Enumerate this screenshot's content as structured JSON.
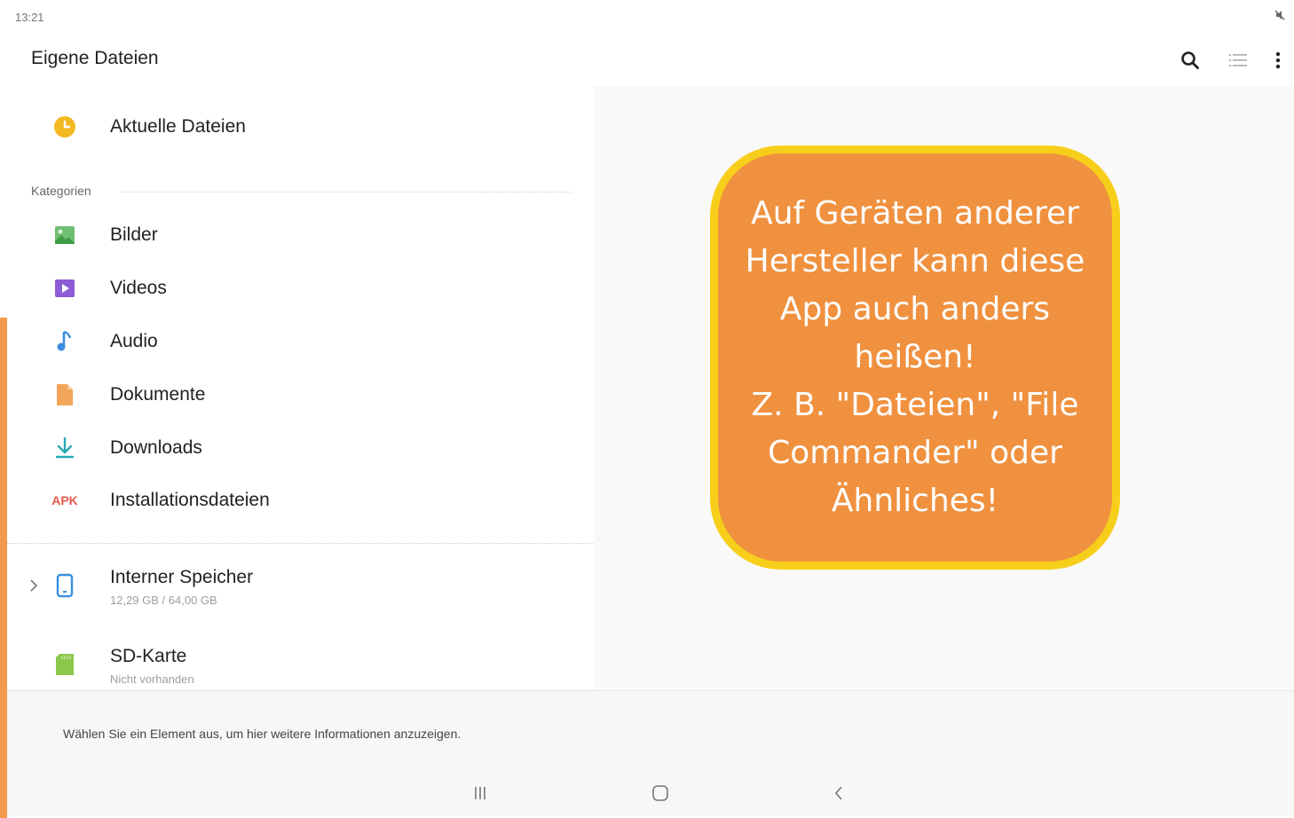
{
  "status_bar": {
    "time": "13:21"
  },
  "header": {
    "title": "Eigene Dateien"
  },
  "sidebar": {
    "recent": {
      "label": "Aktuelle Dateien"
    },
    "categories_label": "Kategorien",
    "categories": [
      {
        "label": "Bilder",
        "icon": "image-icon"
      },
      {
        "label": "Videos",
        "icon": "video-icon"
      },
      {
        "label": "Audio",
        "icon": "music-note-icon"
      },
      {
        "label": "Dokumente",
        "icon": "document-icon"
      },
      {
        "label": "Downloads",
        "icon": "download-icon"
      },
      {
        "label": "Installationsdateien",
        "icon": "apk-icon",
        "icon_text": "APK"
      }
    ],
    "storage": [
      {
        "label": "Interner Speicher",
        "detail": "12,29 GB / 64,00 GB",
        "icon": "phone-icon"
      },
      {
        "label": "SD-Karte",
        "detail": "Nicht vorhanden",
        "icon": "sd-card-icon"
      }
    ]
  },
  "footer": {
    "info_text": "Wählen Sie ein Element aus, um hier weitere Informationen anzuzeigen."
  },
  "callout": {
    "text": "Auf Geräten anderer Hersteller kann diese App auch anders heißen!\nZ. B. \"Dateien\", \"File Commander\" oder Ähnliches!"
  },
  "colors": {
    "accent_orange": "#f0913f",
    "callout_border": "#f7cf1b"
  }
}
